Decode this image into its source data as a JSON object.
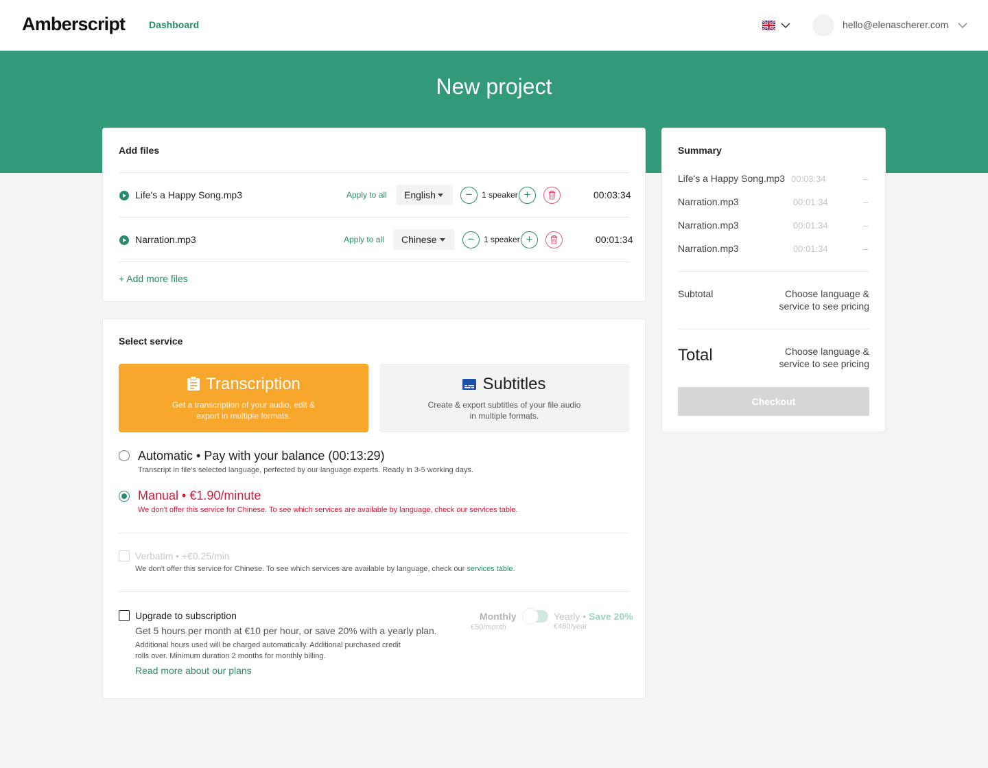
{
  "header": {
    "logo": "Amberscript",
    "nav_dashboard": "Dashboard",
    "user_email": "hello@elenascherer.com"
  },
  "hero": {
    "title": "New project"
  },
  "add_files": {
    "title": "Add files",
    "files": [
      {
        "name": "Life's a Happy Song.mp3",
        "apply_all": "Apply to all",
        "language": "English",
        "speakers": "1 speaker",
        "duration": "00:03:34"
      },
      {
        "name": "Narration.mp3",
        "apply_all": "Apply to all",
        "language": "Chinese",
        "speakers": "1 speaker",
        "duration": "00:01:34"
      }
    ],
    "add_more": "+ Add more files"
  },
  "select_service": {
    "title": "Select service",
    "tiles": [
      {
        "title": "Transcription",
        "desc": "Get a transcription of your audio, edit & export in multiple formats.",
        "icon": "clipboard-icon",
        "selected": true
      },
      {
        "title": "Subtitles",
        "desc": "Create & export subtitles of your file audio in multiple formats.",
        "icon": "subtitles-icon",
        "selected": false
      }
    ],
    "automatic": {
      "title": "Automatic • Pay with your balance (00:13:29)",
      "sub": "Transcript in file's selected language, perfected by our language experts. Ready in 3-5 working days."
    },
    "manual": {
      "title": "Manual • €1.90/minute",
      "sub": "We don't offer this service for Chinese. To see which services are available by language, check our services table."
    },
    "verbatim": {
      "title": "Verbatim • +€0.25/min",
      "sub": "We don't offer this service for Chinese. To see which services are available by language, check our",
      "link": "services table."
    },
    "subscription": {
      "title": "Upgrade to subscription",
      "line1": "Get 5 hours per month at €10 per hour, or save 20% with a yearly plan.",
      "line2a": "Additional hours used will be charged automatically. Additional purchased credit",
      "line2b": "rolls over. Minimum duration 2 months for monthly billing.",
      "link": "Read more about our plans",
      "monthly_label": "Monthly",
      "monthly_price": "€50/month",
      "yearly_label": "Yearly",
      "yearly_sep": "•",
      "yearly_save": "Save 20%",
      "yearly_price": "€480/year"
    }
  },
  "summary": {
    "title": "Summary",
    "rows": [
      {
        "name": "Life's a Happy Song.mp3",
        "duration": "00:03:34",
        "price": "–"
      },
      {
        "name": "Narration.mp3",
        "duration": "00:01:34",
        "price": "–"
      },
      {
        "name": "Narration.mp3",
        "duration": "00:01:34",
        "price": "–"
      },
      {
        "name": "Narration.mp3",
        "duration": "00:01:34",
        "price": "–"
      }
    ],
    "subtotal_label": "Subtotal",
    "subtotal_value_a": "Choose language &",
    "subtotal_value_b": "service to see pricing",
    "total_label": "Total",
    "total_value_a": "Choose language &",
    "total_value_b": "service to see pricing",
    "checkout": "Checkout"
  },
  "colors": {
    "brand_green": "#33997b",
    "link_green": "#2a8a6d",
    "accent_orange": "#f7a82c",
    "error_red": "#d01a3a"
  }
}
